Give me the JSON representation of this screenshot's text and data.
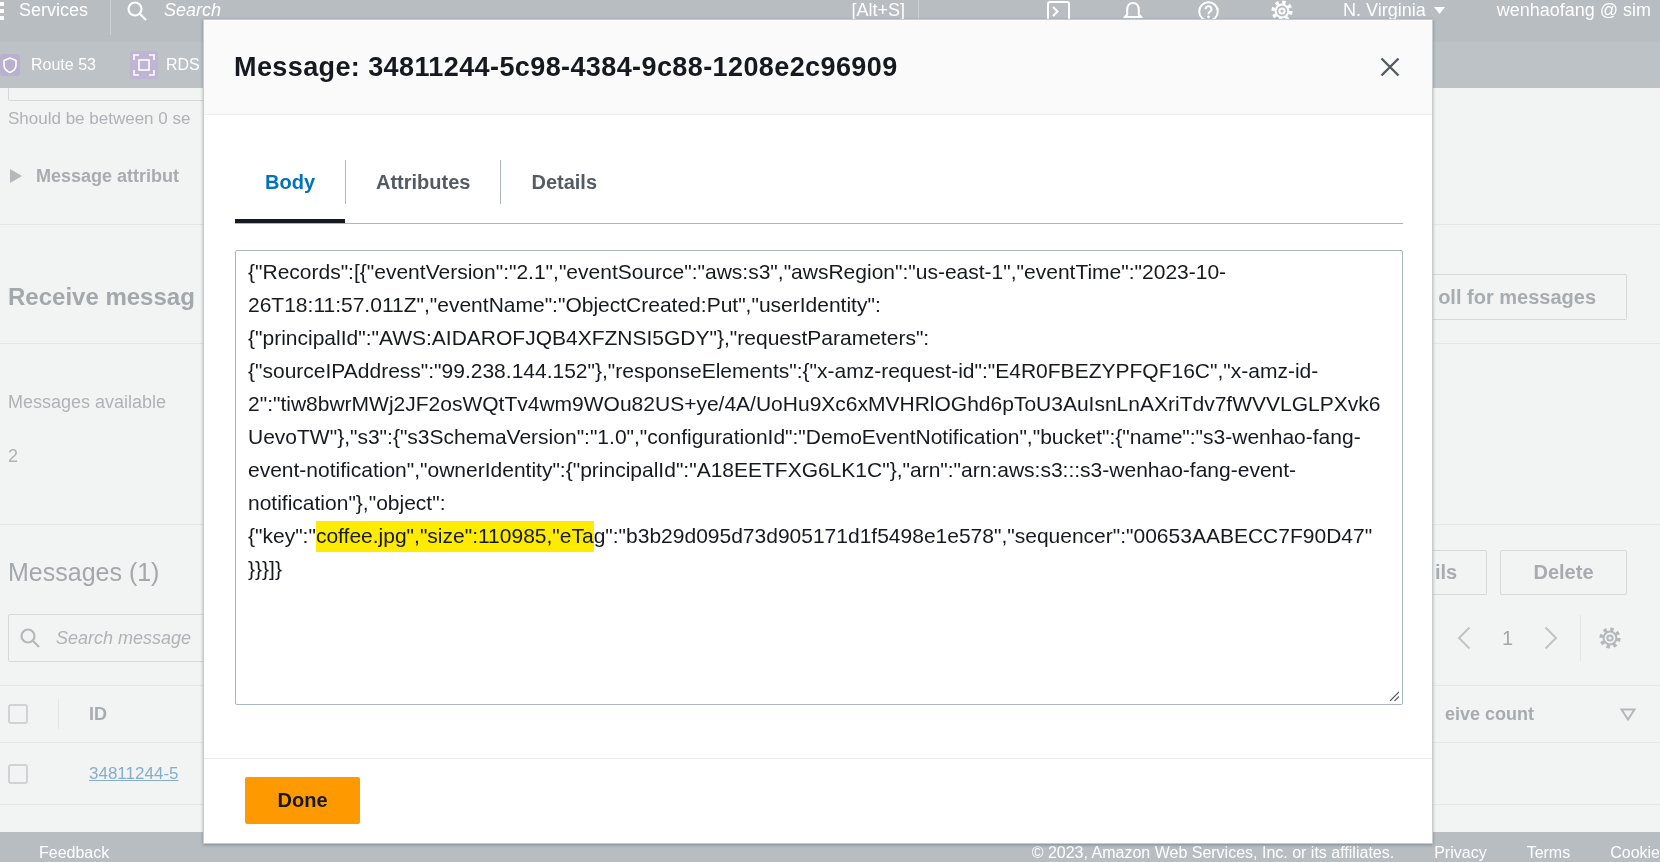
{
  "top_nav": {
    "services_label": "Services",
    "search": {
      "placeholder": "Search",
      "shortcut": "[Alt+S]"
    },
    "region": "N. Virginia",
    "account": "wenhaofang @ sim"
  },
  "favorites_bar": {
    "items": [
      {
        "label": "Route 53",
        "kind": "shield"
      },
      {
        "label": "RDS",
        "kind": "bracket"
      }
    ]
  },
  "send_panel": {
    "delay_hint": "Should be between 0 se",
    "attributes_expander": {
      "label": "Message attribut",
      "expanded": false
    }
  },
  "receive_panel": {
    "title": "Receive messag",
    "poll_button": "oll for messages",
    "available_label": "Messages available",
    "available_value": "2"
  },
  "messages_panel": {
    "title": "Messages (1)",
    "buttons": [
      "ils",
      "Delete"
    ],
    "search": {
      "placeholder": "Search message"
    },
    "pagination": {
      "page": "1"
    },
    "table": {
      "select_all": {
        "checked": false
      },
      "columns": [
        {
          "label": "ID"
        },
        {
          "label": "eive count"
        }
      ],
      "rows": [
        {
          "id": "34811244-5",
          "selected": false
        }
      ]
    }
  },
  "modal": {
    "title": "Message: 34811244-5c98-4384-9c88-1208e2c96909",
    "tabs": [
      {
        "label": "Body",
        "selected": true
      },
      {
        "label": "Attributes",
        "selected": false
      },
      {
        "label": "Details",
        "selected": false
      }
    ],
    "body": {
      "lines": [
        {
          "segments": [
            {
              "text": "{\"Records\":[{\"eventVersion\":\"2.1\",\"eventSource\":\"aws:s3\",\"awsRegion\":\"us-east-1\",\"eventTime\":\"2023-10-",
              "highlighted": false
            }
          ]
        },
        {
          "segments": [
            {
              "text": "26T18:11:57.011Z\",\"eventName\":\"ObjectCreated:Put\",\"userIdentity\":",
              "highlighted": false
            }
          ]
        },
        {
          "segments": [
            {
              "text": "{\"principalId\":\"AWS:AIDAROFJQB4XFZNSI5GDY\"},\"requestParameters\":",
              "highlighted": false
            }
          ]
        },
        {
          "segments": [
            {
              "text": "{\"sourceIPAddress\":\"99.238.144.152\"},\"responseElements\":{\"x-amz-request-id\":\"E4R0FBEZYPFQF16C\",\"x-amz-id-",
              "highlighted": false
            }
          ]
        },
        {
          "segments": [
            {
              "text": "2\":\"tiw8bwrMWj2JF2osWQtTv4wm9WOu82US+ye/4A/UoHu9Xc6xMVHRlOGhd6pToU3AuIsnLnAXriTdv7fWVVLGLPXvk6",
              "highlighted": false
            }
          ]
        },
        {
          "segments": [
            {
              "text": "UevoTW\"},\"s3\":{\"s3SchemaVersion\":\"1.0\",\"configurationId\":\"DemoEventNotification\",\"bucket\":{\"name\":\"s3-wenhao-fang-",
              "highlighted": false
            }
          ]
        },
        {
          "segments": [
            {
              "text": "event-notification\",\"ownerIdentity\":{\"principalId\":\"A18EETFXG6LK1C\"},\"arn\":\"arn:aws:s3:::s3-wenhao-fang-event-",
              "highlighted": false
            }
          ]
        },
        {
          "segments": [
            {
              "text": "notification\"},\"object\":",
              "highlighted": false
            }
          ]
        },
        {
          "segments": [
            {
              "text": "{\"key\":\"",
              "highlighted": false
            },
            {
              "text": "coffee.jpg\",\"size\":110985,\"eTa",
              "highlighted": true
            },
            {
              "text": "g\":\"b3b29d095d73d905171d1f5498e1e578\",\"sequencer\":\"00653AABECC7F90D47\"",
              "highlighted": false
            }
          ]
        },
        {
          "segments": [
            {
              "text": "}}}]}",
              "highlighted": false
            }
          ]
        }
      ]
    },
    "done_button": "Done"
  },
  "footer": {
    "feedback": "Feedback",
    "copyright": "© 2023, Amazon Web Services, Inc. or its affiliates.",
    "links": [
      "Privacy",
      "Terms",
      "Cookie"
    ]
  }
}
